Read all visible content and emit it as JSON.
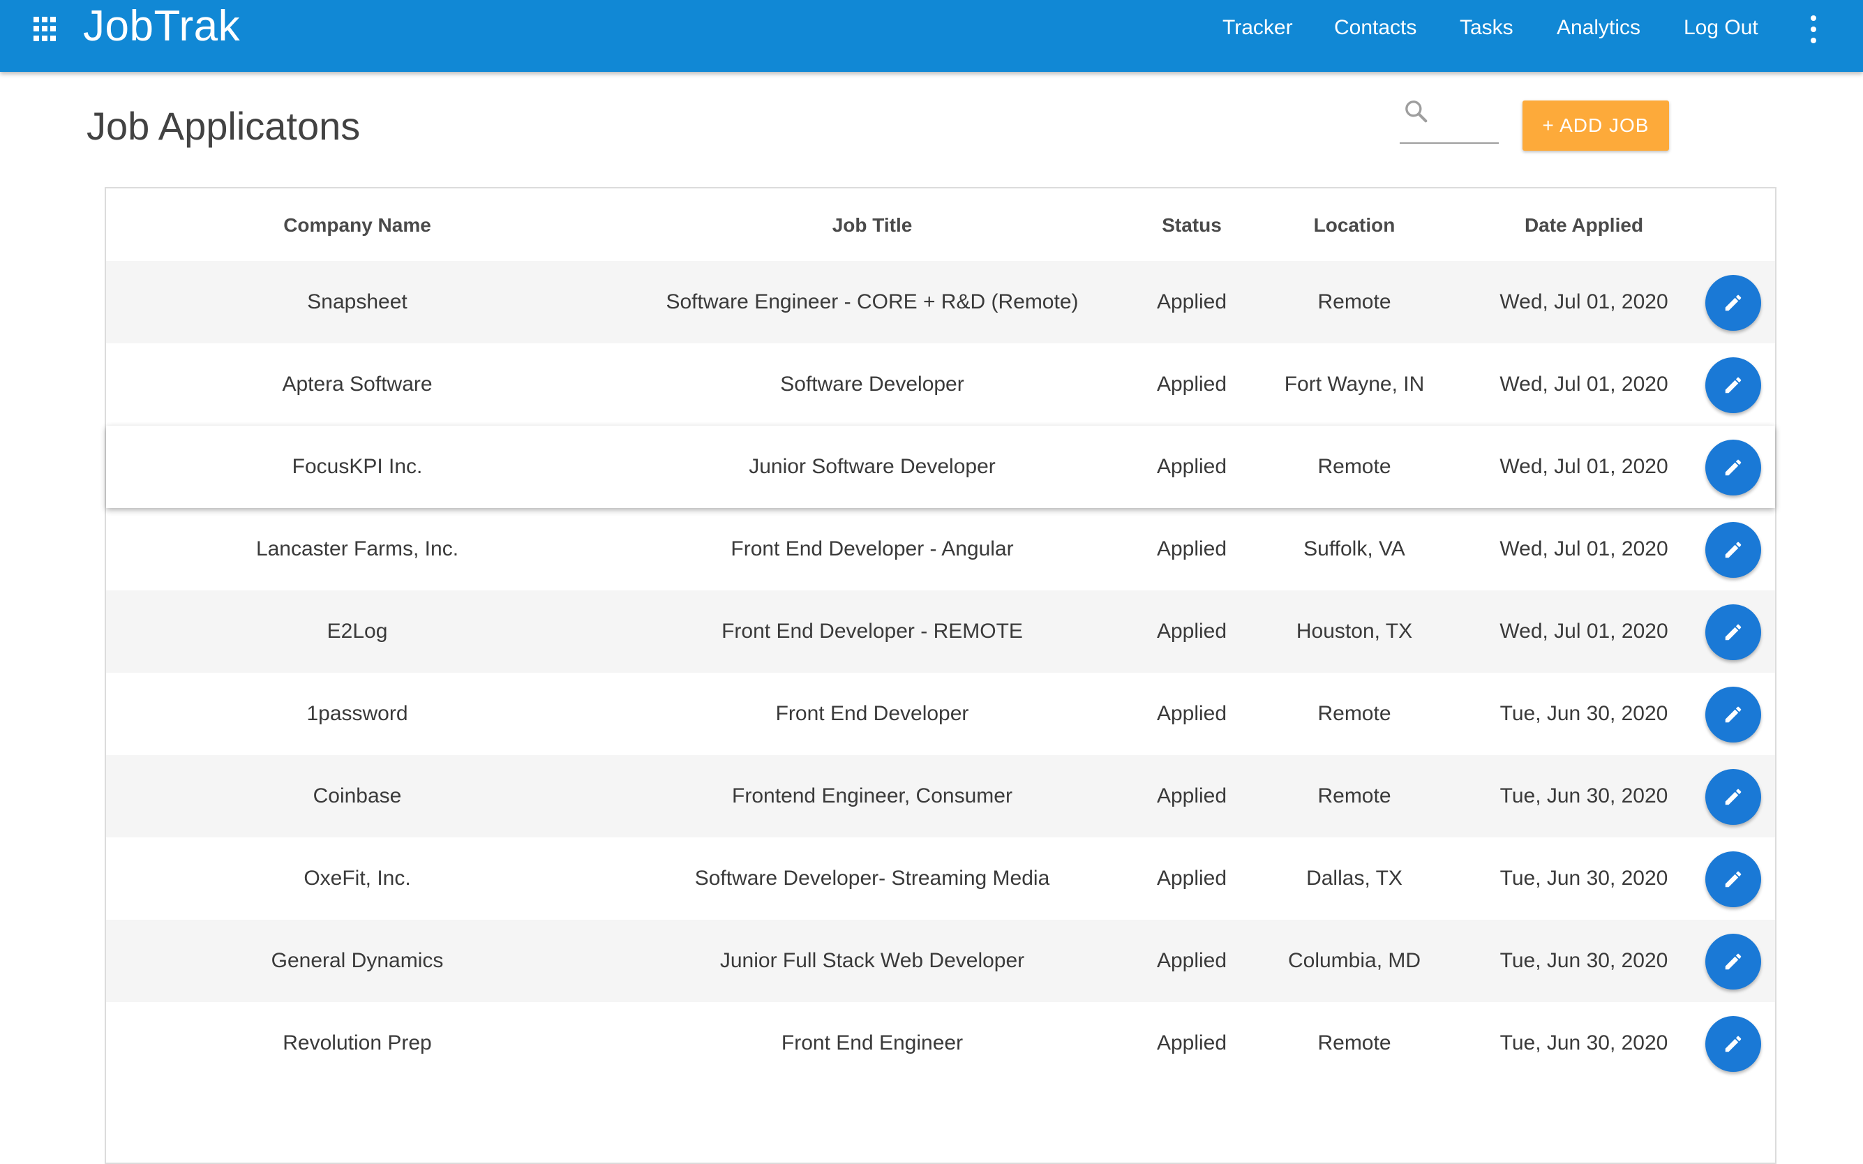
{
  "app": {
    "brand": "JobTrak",
    "nav": [
      "Tracker",
      "Contacts",
      "Tasks",
      "Analytics",
      "Log Out"
    ],
    "icons": {
      "menu": "apps-grid-icon",
      "more": "more-vert-icon"
    },
    "colors": {
      "appbar": "#1188d5",
      "accent": "#fdaa3a",
      "fab": "#1a79d6"
    }
  },
  "page": {
    "title": "Job Applicatons",
    "search": {
      "value": "",
      "placeholder": ""
    },
    "add_job_label": "+ ADD JOB"
  },
  "table": {
    "columns": [
      "Company Name",
      "Job Title",
      "Status",
      "Location",
      "Date Applied"
    ],
    "rows": [
      {
        "company": "Snapsheet",
        "title": "Software Engineer - CORE + R&D (Remote)",
        "status": "Applied",
        "location": "Remote",
        "date": "Wed, Jul 01, 2020"
      },
      {
        "company": "Aptera Software",
        "title": "Software Developer",
        "status": "Applied",
        "location": "Fort Wayne, IN",
        "date": "Wed, Jul 01, 2020"
      },
      {
        "company": "FocusKPI Inc.",
        "title": "Junior Software Developer",
        "status": "Applied",
        "location": "Remote",
        "date": "Wed, Jul 01, 2020"
      },
      {
        "company": "Lancaster Farms, Inc.",
        "title": "Front End Developer - Angular",
        "status": "Applied",
        "location": "Suffolk, VA",
        "date": "Wed, Jul 01, 2020"
      },
      {
        "company": "E2Log",
        "title": "Front End Developer - REMOTE",
        "status": "Applied",
        "location": "Houston, TX",
        "date": "Wed, Jul 01, 2020"
      },
      {
        "company": "1password",
        "title": "Front End Developer",
        "status": "Applied",
        "location": "Remote",
        "date": "Tue, Jun 30, 2020"
      },
      {
        "company": "Coinbase",
        "title": "Frontend Engineer, Consumer",
        "status": "Applied",
        "location": "Remote",
        "date": "Tue, Jun 30, 2020"
      },
      {
        "company": "OxeFit, Inc.",
        "title": "Software Developer- Streaming Media",
        "status": "Applied",
        "location": "Dallas, TX",
        "date": "Tue, Jun 30, 2020"
      },
      {
        "company": "General Dynamics",
        "title": "Junior Full Stack Web Developer",
        "status": "Applied",
        "location": "Columbia, MD",
        "date": "Tue, Jun 30, 2020"
      },
      {
        "company": "Revolution Prep",
        "title": "Front End Engineer",
        "status": "Applied",
        "location": "Remote",
        "date": "Tue, Jun 30, 2020"
      }
    ]
  }
}
